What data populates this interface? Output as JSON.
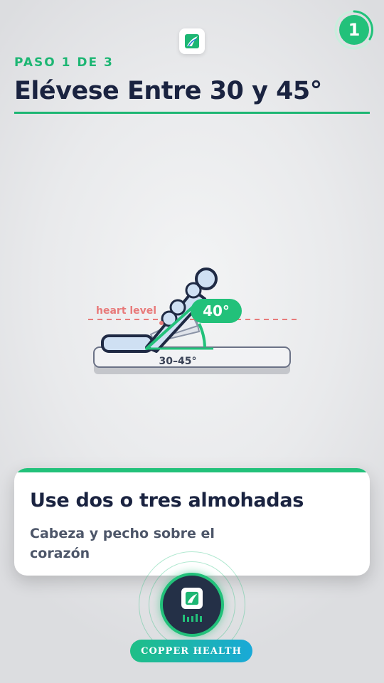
{
  "header": {
    "logo_icon": "copper-health-leaf-icon",
    "step_badge_number": "1",
    "step_label": "PASO 1 DE 3",
    "title": "Elévese Entre 30 y 45°"
  },
  "illustration": {
    "heart_level_label": "heart level",
    "angle_label": "40°",
    "range_label": "30–45°",
    "accent_color": "#22c17a",
    "heart_line_color": "#e87a7a"
  },
  "card": {
    "title": "Use dos o tres almohadas",
    "subtitle": "Cabeza y pecho sobre el corazón"
  },
  "footer": {
    "voice_button_icon": "copper-health-logo-icon",
    "audio_bars_icon": "audio-bars-icon",
    "brand_label": "COPPER HEALTH"
  },
  "colors": {
    "brand_green": "#1db673",
    "navy": "#1a2340",
    "pill_gradient_start": "#1fbf86",
    "pill_gradient_end": "#19a9d8"
  }
}
